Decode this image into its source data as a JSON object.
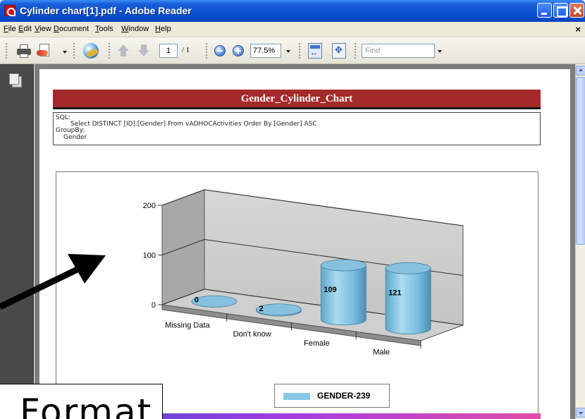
{
  "window": {
    "title": "Cylinder chart[1].pdf - Adobe Reader"
  },
  "menu": {
    "items": [
      {
        "label": "File"
      },
      {
        "label": "Edit"
      },
      {
        "label": "View"
      },
      {
        "label": "Document"
      },
      {
        "label": "Tools"
      },
      {
        "label": "Window"
      },
      {
        "label": "Help"
      }
    ],
    "close_glyph": "×"
  },
  "toolbar": {
    "page_current": "1",
    "page_total": "/ 1",
    "zoom": "77.5%",
    "find_placeholder": "Find"
  },
  "report": {
    "title": "Gender_Cylinder_Chart",
    "sql_label": "SQL:",
    "sql_query": "Select  DISTINCT [ID].[Gender] From vADHOCActivities  Order By [Gender] ASC",
    "groupby_label": "GroupBy:",
    "groupby_value": "Gender"
  },
  "chart_data": {
    "type": "bar",
    "style": "3d-cylinder",
    "categories": [
      "Missing Data",
      "Don't know",
      "Female",
      "Male"
    ],
    "series": [
      {
        "name": "GENDER-239",
        "values": [
          0,
          2,
          109,
          121
        ],
        "color": "#88c8e6"
      }
    ],
    "y_ticks": [
      "0",
      "100",
      "200"
    ],
    "ylim": [
      0,
      200
    ],
    "grid": true,
    "legend_position": "bottom"
  },
  "overlay": {
    "caption": "Format"
  },
  "colors": {
    "titlebar": "#0b4fcf",
    "report_header": "#a52a2a",
    "bar": "#88c8e6"
  }
}
